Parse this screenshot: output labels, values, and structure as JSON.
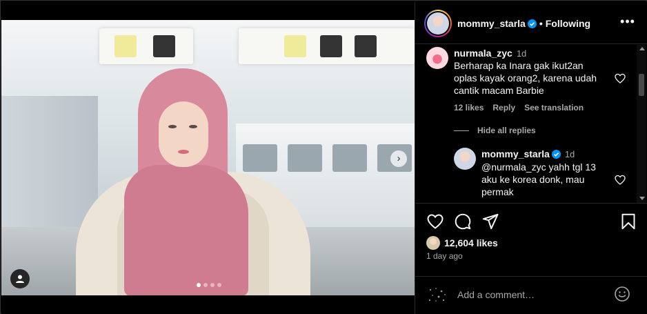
{
  "header": {
    "username": "mommy_starla",
    "separator": "•",
    "follow_status": "Following",
    "more_icon": "more-horizontal-icon"
  },
  "media": {
    "dots_count": 4,
    "active_dot": 0,
    "next_icon": "chevron-right-icon",
    "tag_icon": "user-tag-icon"
  },
  "comments": [
    {
      "username": "nurmala_zyc",
      "time": "1d",
      "text_lines": [
        "Berharap ka Inara gak ikut2an",
        "oplas kayak orang2, karena udah",
        "cantik macam Barbie"
      ],
      "likes": "12 likes",
      "reply": "Reply",
      "translate": "See translation"
    }
  ],
  "hide_replies": "Hide all replies",
  "reply": {
    "username": "mommy_starla",
    "time": "1d",
    "text_lines": [
      "@nurmala_zyc yahh tgl 13",
      "aku ke korea donk, mau",
      "permak"
    ]
  },
  "likes_count": "12,604 likes",
  "posted": "1 day ago",
  "add_comment": {
    "placeholder": "Add a comment…"
  },
  "colors": {
    "verified": "#0095f6",
    "muted": "#a8a8a8",
    "background": "#000000"
  }
}
